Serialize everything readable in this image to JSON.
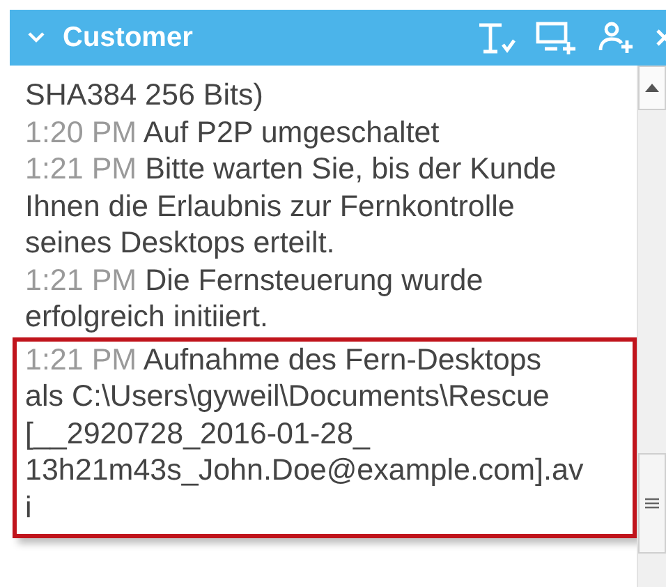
{
  "panel": {
    "title": "Customer",
    "expanded": true
  },
  "messages": [
    {
      "lines": [
        "SHA384 256 Bits)"
      ],
      "highlighted": false
    },
    {
      "time": "1:20 PM",
      "lines": [
        "Auf P2P umgeschaltet"
      ],
      "highlighted": false
    },
    {
      "time": "1:21 PM",
      "lines": [
        "Bitte warten Sie, bis der Kunde",
        "Ihnen die Erlaubnis zur Fernkontrolle",
        "seines Desktops erteilt."
      ],
      "highlighted": false
    },
    {
      "time": "1:21 PM",
      "lines": [
        "Die Fernsteuerung wurde",
        "erfolgreich initiiert."
      ],
      "highlighted": false
    },
    {
      "time": "1:21 PM",
      "lines": [
        "Aufnahme des Fern-Desktops",
        "als C:\\Users\\gyweil\\Documents\\Rescue",
        "[__2920728_2016-01-28_",
        "13h21m43s_John.Doe@example.com].av",
        "i"
      ],
      "highlighted": true
    }
  ]
}
